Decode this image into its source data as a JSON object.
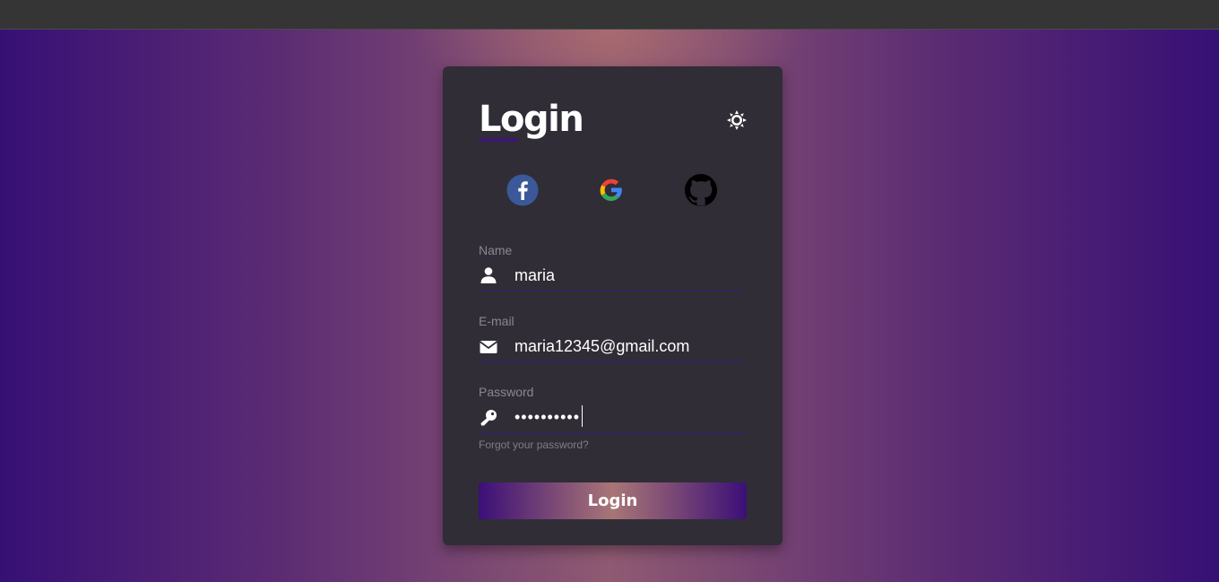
{
  "page": {
    "title": "Login"
  },
  "theme_toggle": {
    "icon": "sun-icon"
  },
  "social": [
    {
      "name": "facebook",
      "icon": "facebook-icon",
      "color": "#3b5998"
    },
    {
      "name": "google",
      "icon": "google-icon"
    },
    {
      "name": "github",
      "icon": "github-icon",
      "color": "#000000"
    }
  ],
  "fields": {
    "name": {
      "label": "Name",
      "value": "maria",
      "icon": "user-icon"
    },
    "email": {
      "label": "E-mail",
      "value": "maria12345@gmail.com",
      "icon": "envelope-icon"
    },
    "password": {
      "label": "Password",
      "value": "••••••••••",
      "icon": "key-icon"
    }
  },
  "forgot_link": "Forgot your password?",
  "login_button": "Login",
  "colors": {
    "card": "#302d36",
    "accent": "#3a1873",
    "bg_edge": "#371075"
  }
}
